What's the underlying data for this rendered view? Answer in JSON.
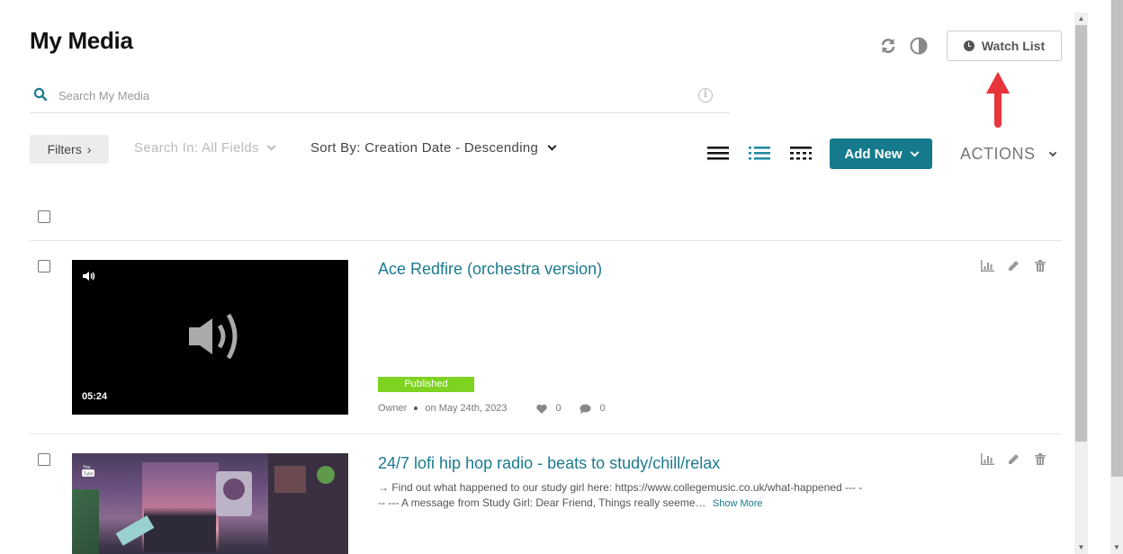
{
  "page": {
    "title": "My Media"
  },
  "search": {
    "placeholder": "Search My Media",
    "value": ""
  },
  "header": {
    "watch_list_label": "Watch List",
    "refresh_icon": "refresh-icon",
    "contrast_icon": "contrast-icon"
  },
  "toolbar": {
    "filters_label": "Filters",
    "search_in_label": "Search In: All Fields",
    "sort_by_label": "Sort By: Creation Date - Descending",
    "view_modes": [
      "details-view",
      "list-view",
      "compact-view"
    ],
    "active_view": "list-view",
    "add_new_label": "Add New",
    "actions_label": "ACTIONS"
  },
  "colors": {
    "accent": "#147a8c",
    "link": "#1b7a8f",
    "published": "#7ed321",
    "annotation_arrow": "#e8343b"
  },
  "entries": [
    {
      "title": "Ace Redfire (orchestra version)",
      "type": "audio",
      "duration": "05:24",
      "status": "Published",
      "owner": "Owner",
      "date": "on May 24th, 2023",
      "likes": "0",
      "comments": "0",
      "description": ""
    },
    {
      "title": "24/7 lofi hip hop radio - beats to study/chill/relax",
      "type": "youtube",
      "description": "→ Find out what happened to our study girl here: https://www.collegemusic.co.uk/what-happened --- --- --- A message from Study Girl: Dear Friend, Things really seeme…",
      "show_more_label": "Show More"
    }
  ]
}
